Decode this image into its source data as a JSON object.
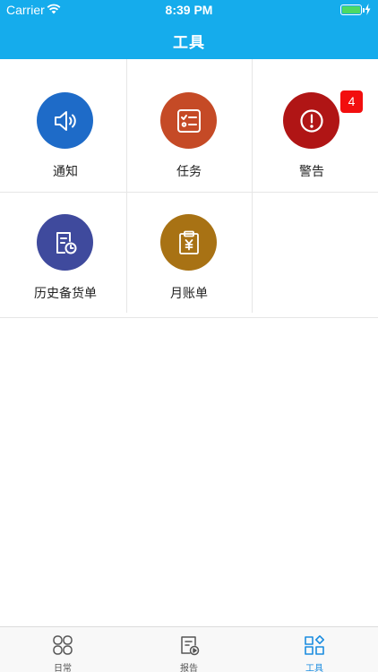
{
  "status_bar": {
    "carrier": "Carrier",
    "time": "8:39 PM"
  },
  "header": {
    "title": "工具"
  },
  "tiles": [
    {
      "label": "通知",
      "icon": "speaker-icon",
      "color": "#1E6BC8"
    },
    {
      "label": "任务",
      "icon": "checklist-icon",
      "color": "#C54A26"
    },
    {
      "label": "警告",
      "icon": "alert-icon",
      "color": "#B01515",
      "badge": "4"
    },
    {
      "label": "历史备货单",
      "icon": "history-document-icon",
      "color": "#3F4A9D"
    },
    {
      "label": "月账单",
      "icon": "monthly-bill-icon",
      "color": "#A87214"
    }
  ],
  "tabbar": {
    "items": [
      {
        "label": "日常",
        "icon": "daily-grid-icon"
      },
      {
        "label": "报告",
        "icon": "report-icon"
      },
      {
        "label": "工具",
        "icon": "tools-icon",
        "active": true
      }
    ],
    "active_color": "#1C8DE0"
  },
  "colors": {
    "header": "#15ACEC",
    "badge": "#F20E0E"
  }
}
